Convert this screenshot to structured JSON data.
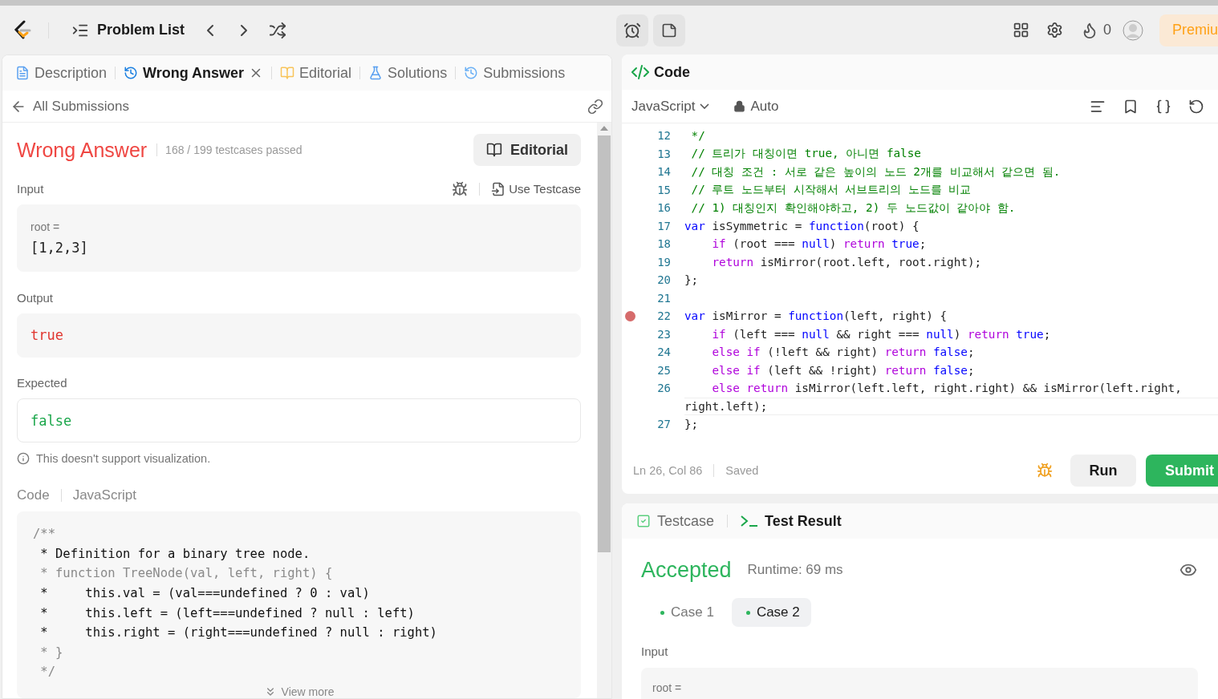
{
  "topbar": {
    "problem_list": "Problem List",
    "flame_count": "0",
    "premium": "Premiu"
  },
  "left": {
    "tabs": [
      {
        "kind": "description",
        "label": "Description",
        "selected": false,
        "closable": false
      },
      {
        "kind": "result",
        "label": "Wrong Answer",
        "selected": true,
        "closable": true
      },
      {
        "kind": "editorial",
        "label": "Editorial",
        "selected": false,
        "closable": false
      },
      {
        "kind": "solutions",
        "label": "Solutions",
        "selected": false,
        "closable": false
      },
      {
        "kind": "submissions",
        "label": "Submissions",
        "selected": false,
        "closable": false
      }
    ],
    "back_link": "All Submissions",
    "result": {
      "status": "Wrong Answer",
      "passed": "168 / 199 testcases passed",
      "editorial_button": "Editorial"
    },
    "input": {
      "label": "Input",
      "use_testcase": "Use Testcase",
      "param": "root =",
      "value": "[1,2,3]"
    },
    "output": {
      "label": "Output",
      "value": "true"
    },
    "expected": {
      "label": "Expected",
      "value": "false"
    },
    "note": "This doesn't support visualization.",
    "code_header": {
      "title": "Code",
      "language": "JavaScript"
    },
    "code_lines": [
      {
        "kind": "muted",
        "text": "/**"
      },
      {
        "kind": "plain",
        "text": " * Definition for a binary tree node."
      },
      {
        "kind": "muted",
        "text": " * function TreeNode(val, left, right) {"
      },
      {
        "kind": "plain",
        "text": " *     this.val = (val===undefined ? 0 : val)"
      },
      {
        "kind": "plain",
        "text": " *     this.left = (left===undefined ? null : left)"
      },
      {
        "kind": "plain",
        "text": " *     this.right = (right===undefined ? null : right)"
      },
      {
        "kind": "muted",
        "text": " * }"
      },
      {
        "kind": "muted",
        "text": " */"
      }
    ],
    "view_more": "View more"
  },
  "editor": {
    "title": "Code",
    "language": "JavaScript",
    "mode": "Auto",
    "lines": [
      {
        "number": "12",
        "breakpoint": false,
        "tokens": [
          {
            "kind": "comment",
            "text": " */"
          }
        ]
      },
      {
        "number": "13",
        "breakpoint": false,
        "tokens": [
          {
            "kind": "comment",
            "text": " // 트리가 대칭이면 true, 아니면 false"
          }
        ]
      },
      {
        "number": "14",
        "breakpoint": false,
        "tokens": [
          {
            "kind": "comment",
            "text": " // 대칭 조건 : 서로 같은 높이의 노드 2개를 비교해서 같으면 됨."
          }
        ]
      },
      {
        "number": "15",
        "breakpoint": false,
        "tokens": [
          {
            "kind": "comment",
            "text": " // 루트 노드부터 시작해서 서브트리의 노드를 비교"
          }
        ]
      },
      {
        "number": "16",
        "breakpoint": false,
        "tokens": [
          {
            "kind": "comment",
            "text": " // 1) 대칭인지 확인해야하고, 2) 두 노드값이 같아야 함."
          }
        ]
      },
      {
        "number": "17",
        "breakpoint": false,
        "tokens": [
          {
            "kind": "keyword",
            "text": "var"
          },
          {
            "kind": "plain",
            "text": " isSymmetric = "
          },
          {
            "kind": "keyword",
            "text": "function"
          },
          {
            "kind": "plain",
            "text": "(root) {"
          }
        ]
      },
      {
        "number": "18",
        "breakpoint": false,
        "tokens": [
          {
            "kind": "control",
            "text": "    if"
          },
          {
            "kind": "plain",
            "text": " (root === "
          },
          {
            "kind": "keyword",
            "text": "null"
          },
          {
            "kind": "plain",
            "text": ") "
          },
          {
            "kind": "control",
            "text": "return"
          },
          {
            "kind": "keyword",
            "text": " true"
          },
          {
            "kind": "plain",
            "text": ";"
          }
        ]
      },
      {
        "number": "19",
        "breakpoint": false,
        "tokens": [
          {
            "kind": "control",
            "text": "    return"
          },
          {
            "kind": "plain",
            "text": " isMirror(root.left, root.right);"
          }
        ]
      },
      {
        "number": "20",
        "breakpoint": false,
        "tokens": [
          {
            "kind": "plain",
            "text": "};"
          }
        ]
      },
      {
        "number": "21",
        "breakpoint": false
      },
      {
        "number": "22",
        "breakpoint": true,
        "tokens": [
          {
            "kind": "keyword",
            "text": "var"
          },
          {
            "kind": "plain",
            "text": " isMirror = "
          },
          {
            "kind": "keyword",
            "text": "function"
          },
          {
            "kind": "plain",
            "text": "(left, right) {"
          }
        ]
      },
      {
        "number": "23",
        "breakpoint": false,
        "tokens": [
          {
            "kind": "control",
            "text": "    if"
          },
          {
            "kind": "plain",
            "text": " (left === "
          },
          {
            "kind": "keyword",
            "text": "null"
          },
          {
            "kind": "plain",
            "text": " && right === "
          },
          {
            "kind": "keyword",
            "text": "null"
          },
          {
            "kind": "plain",
            "text": ") "
          },
          {
            "kind": "control",
            "text": "return"
          },
          {
            "kind": "keyword",
            "text": " true"
          },
          {
            "kind": "plain",
            "text": ";"
          }
        ]
      },
      {
        "number": "24",
        "breakpoint": false,
        "tokens": [
          {
            "kind": "control",
            "text": "    else if"
          },
          {
            "kind": "plain",
            "text": " (!left && right) "
          },
          {
            "kind": "control",
            "text": "return"
          },
          {
            "kind": "keyword",
            "text": " false"
          },
          {
            "kind": "plain",
            "text": ";"
          }
        ]
      },
      {
        "number": "25",
        "breakpoint": false,
        "tokens": [
          {
            "kind": "control",
            "text": "    else if"
          },
          {
            "kind": "plain",
            "text": " (left && !right) "
          },
          {
            "kind": "control",
            "text": "return"
          },
          {
            "kind": "keyword",
            "text": " false"
          },
          {
            "kind": "plain",
            "text": ";"
          }
        ]
      },
      {
        "number": "26",
        "breakpoint": false,
        "tokens": [
          {
            "kind": "control",
            "text": "    else return"
          },
          {
            "kind": "plain",
            "text": " isMirror(left.left, right.right) && isMirror(left.right,"
          }
        ],
        "continuation": [
          {
            "kind": "plain",
            "text": "right.left);"
          }
        ]
      },
      {
        "number": "27",
        "breakpoint": false,
        "tokens": [
          {
            "kind": "plain",
            "text": "};"
          }
        ]
      }
    ],
    "cursor": "Ln 26, Col 86",
    "save_state": "Saved",
    "run": "Run",
    "submit": "Submit"
  },
  "results": {
    "tabs": [
      {
        "kind": "testcase",
        "label": "Testcase",
        "selected": false
      },
      {
        "kind": "result",
        "label": "Test Result",
        "selected": true
      }
    ],
    "status": "Accepted",
    "runtime": "Runtime: 69 ms",
    "cases": [
      {
        "label": "Case 1",
        "selected": false
      },
      {
        "label": "Case 2",
        "selected": true
      }
    ],
    "input_label": "Input",
    "param": "root ="
  }
}
